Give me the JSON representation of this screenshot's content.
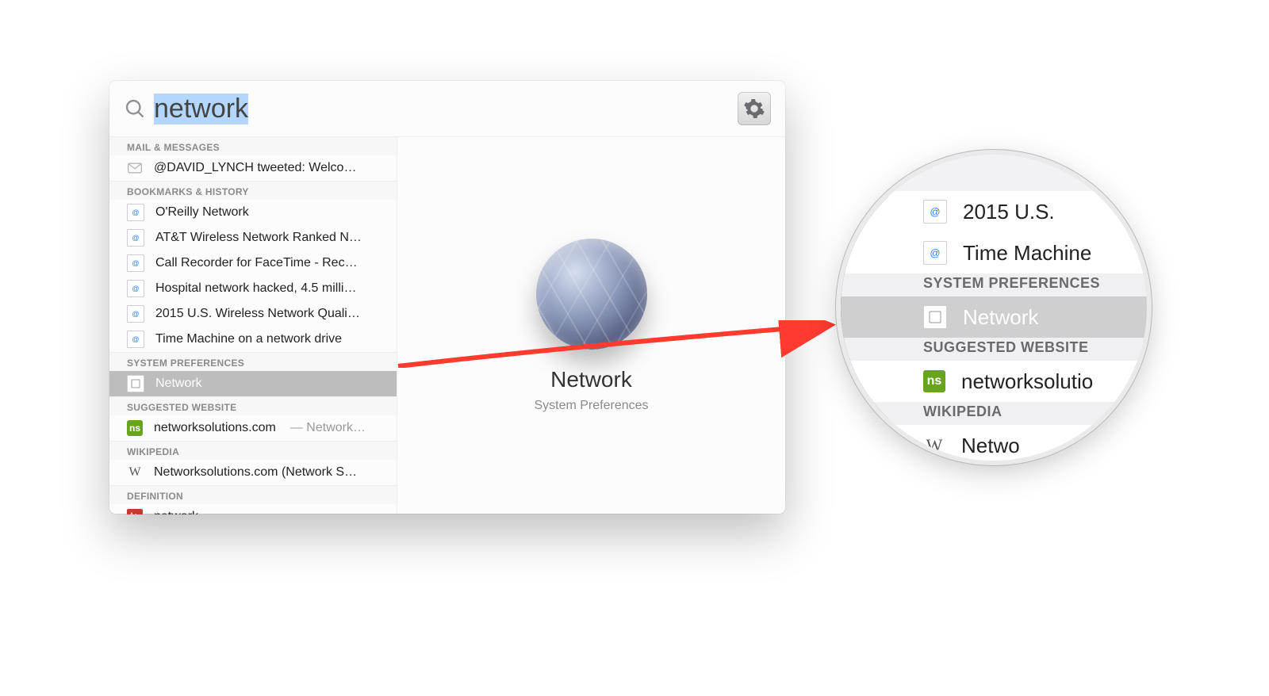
{
  "search": {
    "query": "network"
  },
  "top_hit_icon": "system-preferences-gear",
  "sections": [
    {
      "id": "mail",
      "header": "MAIL & MESSAGES",
      "items": [
        {
          "icon": "mail",
          "label": "@DAVID_LYNCH tweeted: Welco…"
        }
      ]
    },
    {
      "id": "bookmarks",
      "header": "BOOKMARKS & HISTORY",
      "items": [
        {
          "icon": "webloc",
          "label": "O'Reilly Network"
        },
        {
          "icon": "webloc",
          "label": "AT&T Wireless Network Ranked N…"
        },
        {
          "icon": "webloc",
          "label": "Call Recorder for FaceTime - Rec…"
        },
        {
          "icon": "webloc",
          "label": "Hospital network hacked, 4.5 milli…"
        },
        {
          "icon": "webloc",
          "label": "2015 U.S. Wireless Network Quali…"
        },
        {
          "icon": "webloc",
          "label": "Time Machine on a network drive"
        }
      ]
    },
    {
      "id": "sysprefs",
      "header": "SYSTEM PREFERENCES",
      "items": [
        {
          "icon": "prefpane",
          "label": "Network",
          "selected": true
        }
      ]
    },
    {
      "id": "suggested",
      "header": "SUGGESTED WEBSITE",
      "items": [
        {
          "icon": "ns",
          "label": "networksolutions.com",
          "extra": "— Network…"
        }
      ]
    },
    {
      "id": "wikipedia",
      "header": "WIKIPEDIA",
      "items": [
        {
          "icon": "wiki",
          "label": "Networksolutions.com (Network S…"
        }
      ]
    },
    {
      "id": "definition",
      "header": "DEFINITION",
      "items": [
        {
          "icon": "def",
          "label": "network"
        }
      ]
    }
  ],
  "preview": {
    "title": "Network",
    "subtitle": "System Preferences"
  },
  "lens": {
    "rows": [
      {
        "kind": "item",
        "icon": "webloc",
        "text": "2015 U.S."
      },
      {
        "kind": "item",
        "icon": "webloc",
        "text": "Time Machine"
      },
      {
        "kind": "header",
        "text": "SYSTEM PREFERENCES"
      },
      {
        "kind": "item",
        "icon": "prefpane",
        "text": "Network",
        "selected": true
      },
      {
        "kind": "header",
        "text": "SUGGESTED WEBSITE"
      },
      {
        "kind": "item",
        "icon": "ns",
        "text": "networksolutio"
      },
      {
        "kind": "header",
        "text": "WIKIPEDIA"
      },
      {
        "kind": "item",
        "icon": "wiki",
        "text": "Netwo"
      }
    ]
  }
}
